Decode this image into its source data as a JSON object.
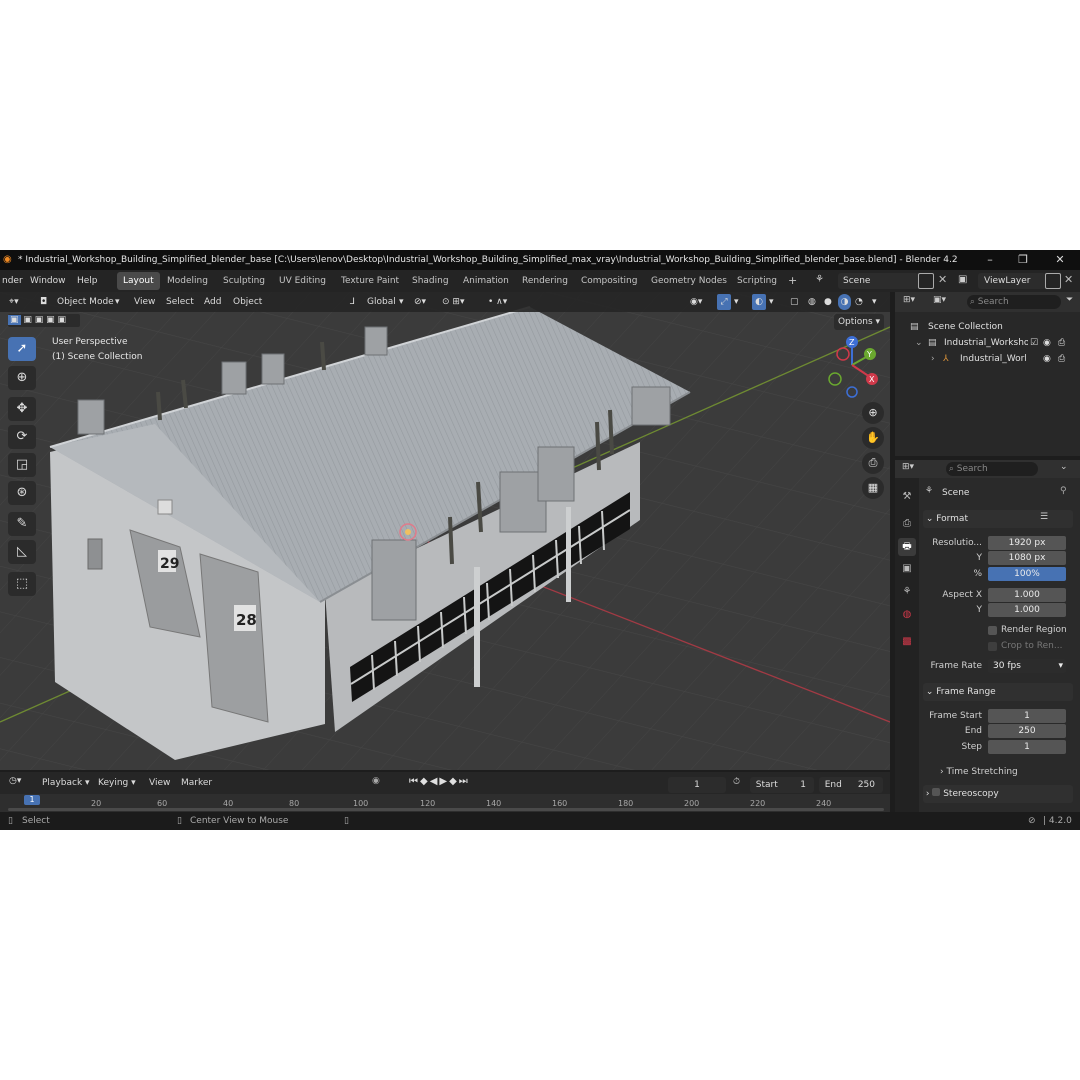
{
  "window": {
    "title": "* Industrial_Workshop_Building_Simplified_blender_base [C:\\Users\\lenov\\Desktop\\Industrial_Workshop_Building_Simplified_max_vray\\Industrial_Workshop_Building_Simplified_blender_base.blend] - Blender 4.2",
    "minimize": "–",
    "maximize": "❐",
    "close": "✕"
  },
  "menu": [
    "nder",
    "Window",
    "Help"
  ],
  "workspaces": [
    "Layout",
    "Modeling",
    "Sculpting",
    "UV Editing",
    "Texture Paint",
    "Shading",
    "Animation",
    "Rendering",
    "Compositing",
    "Geometry Nodes",
    "Scripting"
  ],
  "add_workspace": "+",
  "scene_name": "Scene",
  "view_layer": "ViewLayer",
  "viewport": {
    "mode": "Object Mode",
    "menus": [
      "View",
      "Select",
      "Add",
      "Object"
    ],
    "orientation": "Global",
    "options": "Options",
    "overlay_line1": "User Perspective",
    "overlay_line2": "(1) Scene Collection",
    "gizmo": {
      "z": "Z",
      "y": "Y",
      "x": "X"
    },
    "building_numbers": [
      "29",
      "28"
    ]
  },
  "outliner": {
    "search_placeholder": "Search",
    "root": "Scene Collection",
    "items": [
      "Industrial_Worksho",
      "Industrial_Worl"
    ]
  },
  "properties": {
    "search_placeholder": "Search",
    "context": "Scene",
    "format_panel": "Format",
    "resolution_label": "Resolutio...",
    "res_x": "1920 px",
    "y_label": "Y",
    "res_y": "1080 px",
    "percent_label": "%",
    "percent": "100%",
    "aspect_label": "Aspect X",
    "aspect_x": "1.000",
    "aspect_y": "1.000",
    "render_region": "Render Region",
    "crop": "Crop to Ren...",
    "frame_rate_label": "Frame Rate",
    "frame_rate": "30 fps",
    "frame_range_panel": "Frame Range",
    "frame_start_label": "Frame Start",
    "frame_start": "1",
    "end_label": "End",
    "frame_end": "250",
    "step_label": "Step",
    "step": "1",
    "time_stretching": "Time Stretching",
    "stereoscopy": "Stereoscopy"
  },
  "timeline": {
    "menus": [
      "Playback",
      "Keying",
      "View",
      "Marker"
    ],
    "current_frame": "1",
    "start_label": "Start",
    "start": "1",
    "end_label": "End",
    "end": "250",
    "ticks": [
      "1",
      "20",
      "60",
      "40",
      "80",
      "100",
      "120",
      "140",
      "160",
      "180",
      "200",
      "220",
      "240"
    ]
  },
  "status": {
    "select": "Select",
    "center": "Center View to Mouse",
    "version": "4.2.0"
  },
  "colors": {
    "accent": "#4772b3",
    "bg": "#1d1d1d",
    "viewport": "#3a3a3a"
  }
}
